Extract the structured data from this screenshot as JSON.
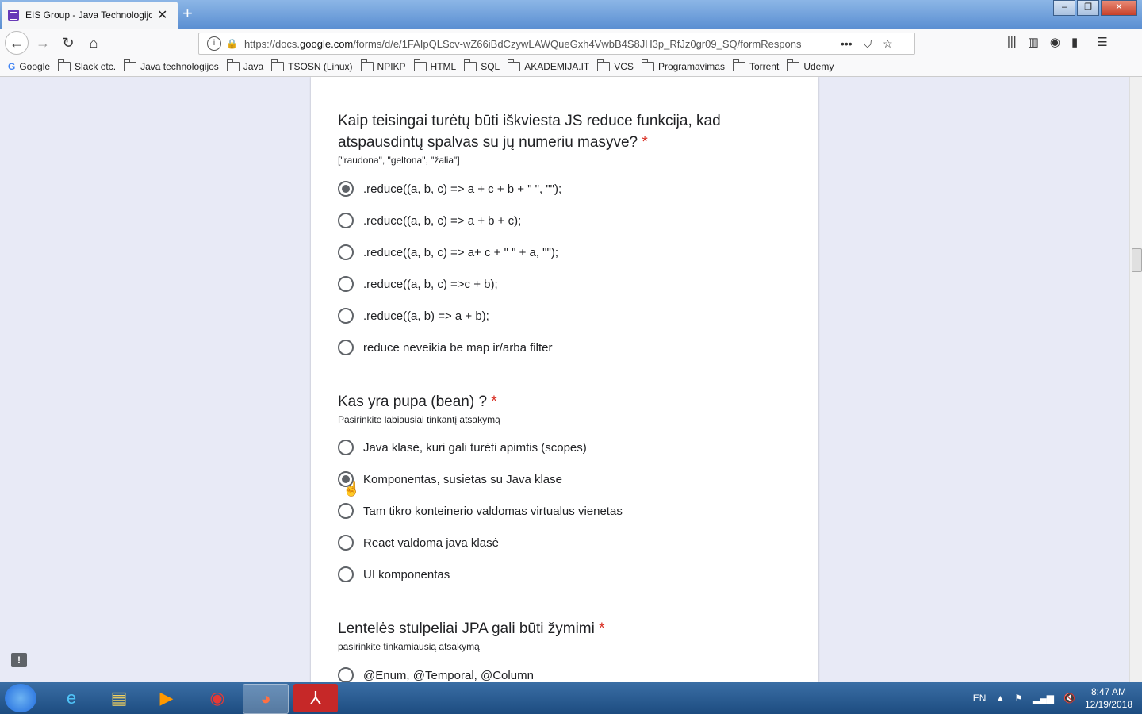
{
  "browser": {
    "tab_title": "EIS Group - Java Technologijos",
    "url_host_prefix": "https://docs.",
    "url_host": "google.com",
    "url_path": "/forms/d/e/1FAIpQLScv-wZ66iBdCzywLAWQueGxh4VwbB4S8JH3p_RfJz0gr09_SQ/formRespons",
    "bookmarks": [
      "Google",
      "Slack etc.",
      "Java technologijos",
      "Java",
      "TSOSN (Linux)",
      "NPIKP",
      "HTML",
      "SQL",
      "AKADEMIJA.IT",
      "VCS",
      "Programavimas",
      "Torrent",
      "Udemy"
    ]
  },
  "form": {
    "q1": {
      "title": "Kaip teisingai turėtų būti iškviesta JS reduce funkcija, kad atspausdintų spalvas su jų numeriu masyve?",
      "required_mark": "*",
      "description": "[\"raudona\", \"geltona\", \"žalia\"]",
      "options": [
        ".reduce((a, b, c) => a + c + b + \" \", \"\");",
        ".reduce((a, b, c) => a + b + c);",
        ".reduce((a, b, c) => a+ c + \" \" + a, \"\");",
        ".reduce((a, b, c) =>c + b);",
        ".reduce((a, b) => a + b);",
        "reduce neveikia be map ir/arba filter"
      ],
      "selected_index": 0
    },
    "q2": {
      "title": "Kas yra pupa (bean) ?",
      "required_mark": "*",
      "description": "Pasirinkite labiausiai tinkantį atsakymą",
      "options": [
        "Java klasė, kuri gali turėti apimtis (scopes)",
        "Komponentas, susietas su Java klase",
        "Tam tikro konteinerio valdomas virtualus vienetas",
        "React valdoma java klasė",
        "UI komponentas"
      ],
      "selected_index": 1
    },
    "q3": {
      "title": "Lentelės stulpeliai JPA gali būti žymimi",
      "required_mark": "*",
      "description": "pasirinkite tinkamiausią atsakymą",
      "options": [
        "@Enum, @Temporal, @Column"
      ]
    }
  },
  "taskbar": {
    "language": "EN",
    "time": "8:47 AM",
    "date": "12/19/2018"
  }
}
